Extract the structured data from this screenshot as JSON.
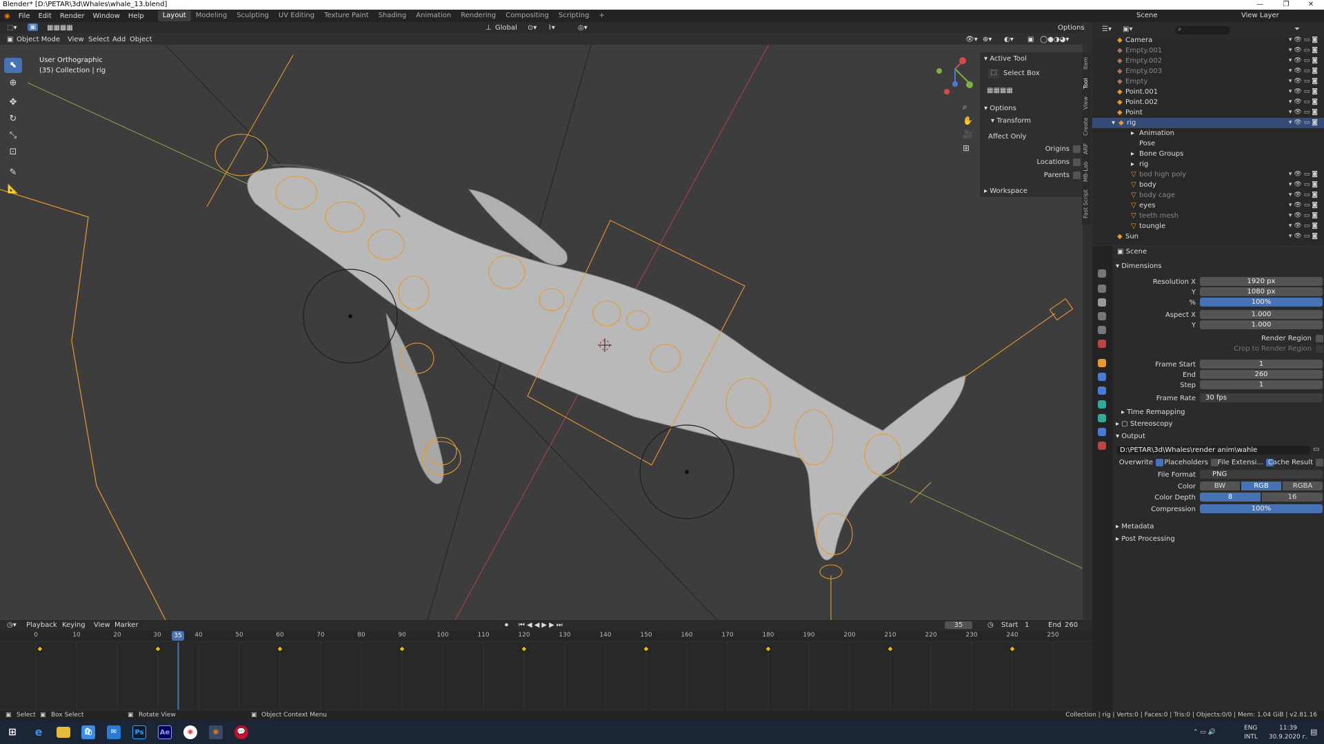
{
  "window": {
    "title": "Blender* [D:\\PETAR\\3d\\Whales\\whale_13.blend]",
    "controls": [
      "—",
      "❐",
      "✕"
    ]
  },
  "menubar": {
    "items": [
      "File",
      "Edit",
      "Render",
      "Window",
      "Help"
    ],
    "workspaces": [
      "Layout",
      "Modeling",
      "Sculpting",
      "UV Editing",
      "Texture Paint",
      "Shading",
      "Animation",
      "Rendering",
      "Compositing",
      "Scripting"
    ],
    "add": "+",
    "scene": "Scene",
    "view_layer": "View Layer"
  },
  "viewport_header": {
    "transform": "Global",
    "options": "Options",
    "mode": "Object Mode",
    "menus": [
      "View",
      "Select",
      "Add",
      "Object"
    ]
  },
  "viewport": {
    "view_name": "User Orthographic",
    "collection": "(35) Collection | rig"
  },
  "npanel": {
    "active_tool": "Active Tool",
    "tool_name": "Select Box",
    "options": "Options",
    "transform": "Transform",
    "affect_only": "Affect Only",
    "origins": "Origins",
    "locations": "Locations",
    "parents": "Parents",
    "workspace": "Workspace",
    "tabs": [
      "Item",
      "Tool",
      "View",
      "Create",
      "ARP",
      "MB-Lab",
      "Fast Script"
    ]
  },
  "outliner": {
    "rows": [
      {
        "name": "Camera",
        "dim": false
      },
      {
        "name": "Empty.001",
        "dim": true
      },
      {
        "name": "Empty.002",
        "dim": true
      },
      {
        "name": "Empty.003",
        "dim": true
      },
      {
        "name": "Empty",
        "dim": true
      },
      {
        "name": "Point.001",
        "dim": false
      },
      {
        "name": "Point.002",
        "dim": false
      },
      {
        "name": "Point",
        "dim": false
      },
      {
        "name": "rig",
        "dim": false,
        "selected": true
      },
      {
        "name": "Animation",
        "dim": false
      },
      {
        "name": "Pose",
        "dim": false
      },
      {
        "name": "Bone Groups",
        "dim": false
      },
      {
        "name": "rig",
        "dim": false
      },
      {
        "name": "bod high poly",
        "dim": true
      },
      {
        "name": "body",
        "dim": false
      },
      {
        "name": "body cage",
        "dim": true
      },
      {
        "name": "eyes",
        "dim": false
      },
      {
        "name": "teeth mesh",
        "dim": true
      },
      {
        "name": "toungle",
        "dim": false
      },
      {
        "name": "Sun",
        "dim": false
      }
    ]
  },
  "properties": {
    "context": "Scene",
    "dimensions": "Dimensions",
    "resolution_x_label": "Resolution X",
    "resolution_x": "1920 px",
    "y_label": "Y",
    "resolution_y": "1080 px",
    "pct_label": "%",
    "pct": "100%",
    "aspect_x_label": "Aspect X",
    "aspect_x": "1.000",
    "aspect_y": "1.000",
    "render_region": "Render Region",
    "crop_region": "Crop to Render Region",
    "frame_start_label": "Frame Start",
    "frame_start": "1",
    "end_label": "End",
    "frame_end": "260",
    "step_label": "Step",
    "step": "1",
    "frame_rate_label": "Frame Rate",
    "frame_rate": "30 fps",
    "time_remapping": "Time Remapping",
    "stereoscopy": "Stereoscopy",
    "output": "Output",
    "output_path": "D:\\PETAR\\3d\\Whales\\render anim\\wahle",
    "overwrite": "Overwrite",
    "placeholders": "Placeholders",
    "file_ext": "File Extensi...",
    "cache_result": "Cache Result",
    "file_format_label": "File Format",
    "file_format": "PNG",
    "color_label": "Color",
    "color_modes": [
      "BW",
      "RGB",
      "RGBA"
    ],
    "color_depth_label": "Color Depth",
    "color_depths": [
      "8",
      "16"
    ],
    "compression_label": "Compression",
    "compression": "100%",
    "metadata": "Metadata",
    "post_processing": "Post Processing"
  },
  "timeline": {
    "menus": [
      "Playback",
      "Keying",
      "View",
      "Marker"
    ],
    "current_frame": "35",
    "start_label": "Start",
    "start": "1",
    "end_label": "End",
    "end": "260",
    "ruler_ticks": [
      "0",
      "10",
      "20",
      "30",
      "40",
      "50",
      "60",
      "70",
      "80",
      "90",
      "100",
      "110",
      "120",
      "130",
      "140",
      "150",
      "160",
      "170",
      "180",
      "190",
      "200",
      "210",
      "220",
      "230",
      "240",
      "250"
    ],
    "keyframes": [
      1,
      30,
      60,
      90,
      120,
      150,
      180,
      210,
      240
    ]
  },
  "statusbar": {
    "select": "Select",
    "box_select": "Box Select",
    "rotate_view": "Rotate View",
    "context_menu": "Object Context Menu",
    "stats": "Collection | rig | Verts:0 | Faces:0 | Tris:0 | Objects:0/0 | Mem: 1.04 GiB | v2.81.16"
  },
  "taskbar": {
    "lang": "ENG",
    "layout": "INTL",
    "time": "11:39",
    "date": "30.9.2020 г."
  }
}
